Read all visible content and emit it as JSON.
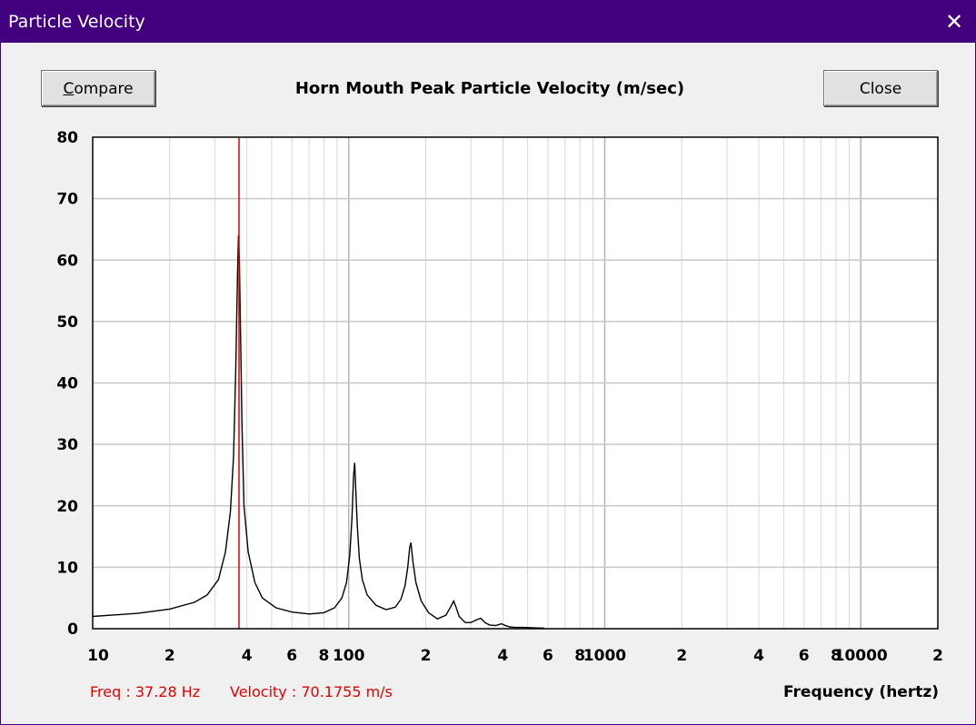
{
  "window": {
    "title": "Particle Velocity",
    "close_glyph": "✕"
  },
  "buttons": {
    "compare_label": "Compare",
    "compare_accel": "C",
    "close_label": "Close"
  },
  "chart_data": {
    "type": "line",
    "title": "Horn Mouth Peak Particle Velocity (m/sec)",
    "xlabel": "Frequency (hertz)",
    "ylabel": "",
    "x_scale": "log",
    "xlim": [
      10,
      20000
    ],
    "ylim": [
      0,
      80
    ],
    "grid": true,
    "y_ticks": [
      0,
      10,
      20,
      30,
      40,
      50,
      60,
      70,
      80
    ],
    "x_tick_labels": [
      {
        "value": 10,
        "label": "10"
      },
      {
        "value": 20,
        "label": "2"
      },
      {
        "value": 40,
        "label": "4"
      },
      {
        "value": 60,
        "label": "6"
      },
      {
        "value": 80,
        "label": "8"
      },
      {
        "value": 100,
        "label": "100"
      },
      {
        "value": 200,
        "label": "2"
      },
      {
        "value": 400,
        "label": "4"
      },
      {
        "value": 600,
        "label": "6"
      },
      {
        "value": 800,
        "label": "8"
      },
      {
        "value": 1000,
        "label": "1000"
      },
      {
        "value": 2000,
        "label": "2"
      },
      {
        "value": 4000,
        "label": "4"
      },
      {
        "value": 6000,
        "label": "6"
      },
      {
        "value": 8000,
        "label": "8"
      },
      {
        "value": 10000,
        "label": "10000"
      },
      {
        "value": 20000,
        "label": "2"
      }
    ],
    "series": [
      {
        "color": "#000000",
        "x": [
          10,
          15,
          20,
          25,
          28,
          31,
          33,
          34.5,
          35.5,
          36.2,
          36.8,
          37.1,
          37.4,
          37.8,
          38.3,
          39,
          40.5,
          43,
          46,
          52,
          60,
          70,
          80,
          88,
          94,
          98,
          101,
          103,
          104.5,
          105.5,
          106.5,
          108,
          110,
          113,
          118,
          128,
          140,
          152,
          160,
          166,
          170,
          173,
          175,
          178,
          183,
          192,
          205,
          222,
          240,
          252,
          257,
          262,
          270,
          285,
          300,
          318,
          328,
          340,
          355,
          375,
          395,
          410,
          425,
          445,
          480,
          520,
          560,
          580
        ],
        "y": [
          2.0,
          2.5,
          3.2,
          4.3,
          5.5,
          8.0,
          12.5,
          19,
          28,
          42,
          58,
          64,
          60,
          48,
          33,
          20,
          12.5,
          7.5,
          5.0,
          3.4,
          2.7,
          2.4,
          2.6,
          3.4,
          5.0,
          7.5,
          12,
          18,
          25,
          27,
          23,
          17,
          11.5,
          8.0,
          5.5,
          3.8,
          3.1,
          3.5,
          4.8,
          7.0,
          10,
          13.2,
          14,
          11,
          7.5,
          4.5,
          2.6,
          1.6,
          2.2,
          3.8,
          4.5,
          3.6,
          2.0,
          1.0,
          1.0,
          1.5,
          1.7,
          1.0,
          0.6,
          0.5,
          0.8,
          0.5,
          0.3,
          0.2,
          0.2,
          0.15,
          0.1,
          0.1
        ]
      }
    ],
    "cursor_frequency": 37.28
  },
  "cursor": {
    "freq_text": "Freq : 37.28 Hz",
    "velocity_text": "Velocity : 70.1755 m/s"
  },
  "colors": {
    "titlebar": "#42007f",
    "cursor": "#e00000",
    "grid": "#c8c8c8",
    "plot_bg": "#ffffff"
  }
}
